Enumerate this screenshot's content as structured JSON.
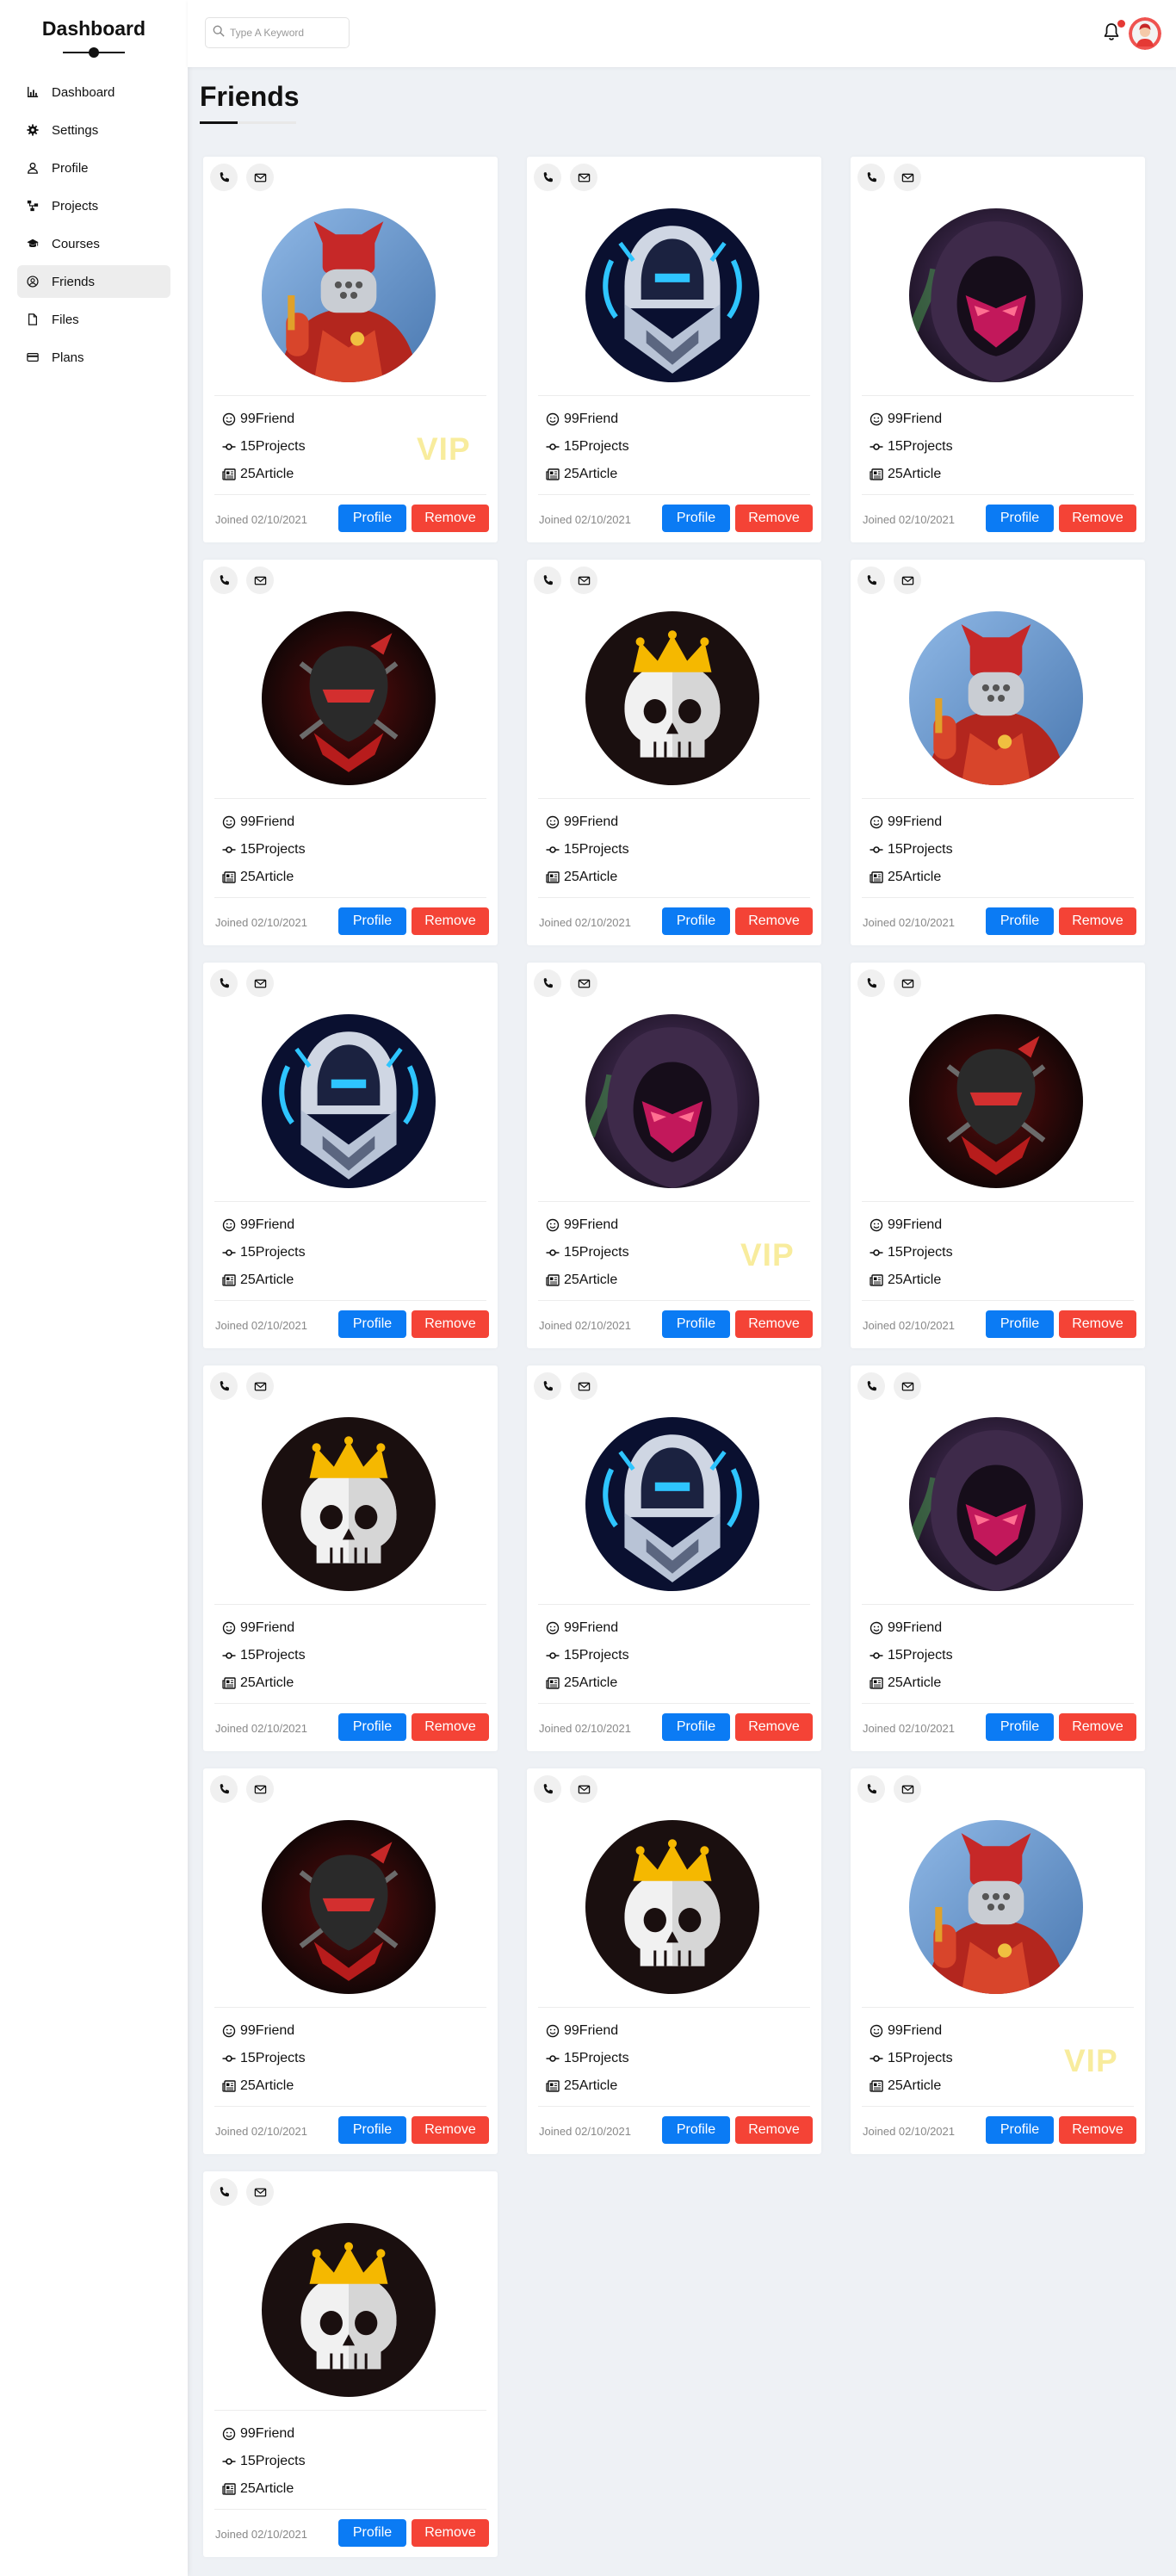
{
  "app": {
    "brand": "Dashboard",
    "page_title": "Friends"
  },
  "sidebar": {
    "items": [
      {
        "label": "Dashboard",
        "icon": "chart-icon"
      },
      {
        "label": "Settings",
        "icon": "gear-icon"
      },
      {
        "label": "Profile",
        "icon": "user-icon"
      },
      {
        "label": "Projects",
        "icon": "diagram-icon"
      },
      {
        "label": "Courses",
        "icon": "graduation-cap-icon"
      },
      {
        "label": "Friends",
        "icon": "user-circle-icon",
        "active": true
      },
      {
        "label": "Files",
        "icon": "file-icon"
      },
      {
        "label": "Plans",
        "icon": "credit-card-icon"
      }
    ]
  },
  "header": {
    "search_placeholder": "Type A Keyword",
    "has_notification": true
  },
  "colors": {
    "primary": "#0b7bf4",
    "danger": "#f44336",
    "vip": "#f7e98d",
    "notification_dot": "#e53935"
  },
  "card_labels": {
    "profile_button": "Profile",
    "remove_button": "Remove",
    "vip_badge": "VIP"
  },
  "friends": [
    {
      "avatar": "red-warrior",
      "friends": "99Friend",
      "projects": "15Projects",
      "articles": "25Article",
      "joined": "Joined 02/10/2021",
      "vip": true
    },
    {
      "avatar": "blue-assassin",
      "friends": "99Friend",
      "projects": "15Projects",
      "articles": "25Article",
      "joined": "Joined 02/10/2021",
      "vip": false
    },
    {
      "avatar": "purple-hood",
      "friends": "99Friend",
      "projects": "15Projects",
      "articles": "25Article",
      "joined": "Joined 02/10/2021",
      "vip": false
    },
    {
      "avatar": "red-ninja",
      "friends": "99Friend",
      "projects": "15Projects",
      "articles": "25Article",
      "joined": "Joined 02/10/2021",
      "vip": false
    },
    {
      "avatar": "skull-king",
      "friends": "99Friend",
      "projects": "15Projects",
      "articles": "25Article",
      "joined": "Joined 02/10/2021",
      "vip": false
    },
    {
      "avatar": "red-warrior",
      "friends": "99Friend",
      "projects": "15Projects",
      "articles": "25Article",
      "joined": "Joined 02/10/2021",
      "vip": false
    },
    {
      "avatar": "blue-assassin",
      "friends": "99Friend",
      "projects": "15Projects",
      "articles": "25Article",
      "joined": "Joined 02/10/2021",
      "vip": false
    },
    {
      "avatar": "purple-hood",
      "friends": "99Friend",
      "projects": "15Projects",
      "articles": "25Article",
      "joined": "Joined 02/10/2021",
      "vip": true
    },
    {
      "avatar": "red-ninja",
      "friends": "99Friend",
      "projects": "15Projects",
      "articles": "25Article",
      "joined": "Joined 02/10/2021",
      "vip": false
    },
    {
      "avatar": "skull-king",
      "friends": "99Friend",
      "projects": "15Projects",
      "articles": "25Article",
      "joined": "Joined 02/10/2021",
      "vip": false
    },
    {
      "avatar": "blue-assassin",
      "friends": "99Friend",
      "projects": "15Projects",
      "articles": "25Article",
      "joined": "Joined 02/10/2021",
      "vip": false
    },
    {
      "avatar": "purple-hood",
      "friends": "99Friend",
      "projects": "15Projects",
      "articles": "25Article",
      "joined": "Joined 02/10/2021",
      "vip": false
    },
    {
      "avatar": "red-ninja",
      "friends": "99Friend",
      "projects": "15Projects",
      "articles": "25Article",
      "joined": "Joined 02/10/2021",
      "vip": false
    },
    {
      "avatar": "skull-king",
      "friends": "99Friend",
      "projects": "15Projects",
      "articles": "25Article",
      "joined": "Joined 02/10/2021",
      "vip": false
    },
    {
      "avatar": "red-warrior",
      "friends": "99Friend",
      "projects": "15Projects",
      "articles": "25Article",
      "joined": "Joined 02/10/2021",
      "vip": true
    },
    {
      "avatar": "skull-king",
      "friends": "99Friend",
      "projects": "15Projects",
      "articles": "25Article",
      "joined": "Joined 02/10/2021",
      "vip": false
    }
  ]
}
